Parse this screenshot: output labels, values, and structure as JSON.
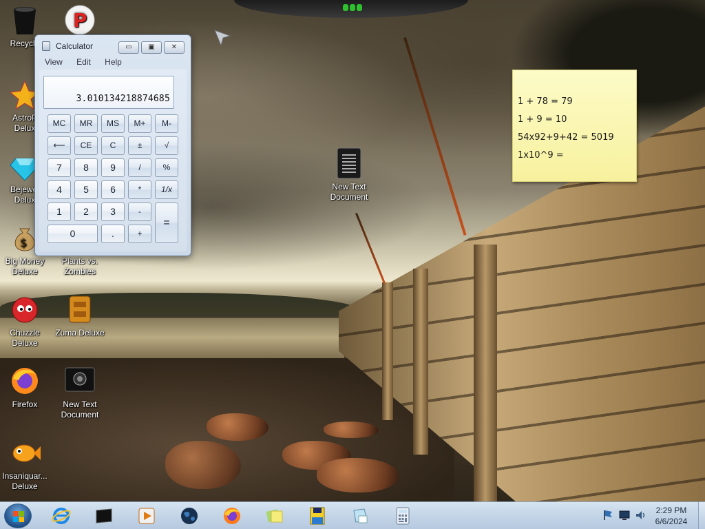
{
  "top_gadget": {},
  "desktop_icons": [
    {
      "id": "recycle-bin",
      "label": "Recycle"
    },
    {
      "id": "p-game",
      "label": ""
    },
    {
      "id": "astropop",
      "label_line1": "AstroP",
      "label_line2": "Delux"
    },
    {
      "id": "bejeweled",
      "label_line1": "Bejewel",
      "label_line2": "Delux"
    },
    {
      "id": "big-money",
      "label_line1": "Big Money",
      "label_line2": "Deluxe"
    },
    {
      "id": "plants-vs-zombies",
      "label_line1": "Plants vs.",
      "label_line2": "Zombies"
    },
    {
      "id": "chuzzle",
      "label_line1": "Chuzzle",
      "label_line2": "Deluxe"
    },
    {
      "id": "zuma",
      "label_line1": "Zuma Deluxe",
      "label_line2": ""
    },
    {
      "id": "firefox",
      "label_line1": "Firefox",
      "label_line2": ""
    },
    {
      "id": "new-text-document-1",
      "label_line1": "New Text",
      "label_line2": "Document"
    },
    {
      "id": "insaniquarium",
      "label_line1": "Insaniquar...",
      "label_line2": "Deluxe"
    },
    {
      "id": "new-text-document-2",
      "label_line1": "New Text",
      "label_line2": "Document"
    }
  ],
  "calculator": {
    "title": "Calculator",
    "window_buttons": {
      "minimize": "▭",
      "maximize": "▣",
      "close": "✕"
    },
    "menu": [
      "View",
      "Edit",
      "Help"
    ],
    "display_value": "3.010134218874685",
    "keys": {
      "mc": "MC",
      "mr": "MR",
      "ms": "MS",
      "mplus": "M+",
      "mminus": "M-",
      "backspace": "⟵",
      "ce": "CE",
      "c": "C",
      "plusminus": "±",
      "sqrt": "√",
      "n7": "7",
      "n8": "8",
      "n9": "9",
      "divide": "/",
      "percent": "%",
      "n4": "4",
      "n5": "5",
      "n6": "6",
      "multiply": "*",
      "reciprocal": "1/x",
      "n1": "1",
      "n2": "2",
      "n3": "3",
      "minus": "-",
      "equals": "=",
      "n0": "0",
      "decimal": ".",
      "plus": "+"
    }
  },
  "sticky_note": {
    "lines": [
      "1 + 78 = 79",
      "1 + 9 = 10",
      "54x92+9+42 = 5019",
      "1x10^9 ="
    ]
  },
  "taskbar": {
    "apps": [
      "Internet Explorer",
      "Media Center",
      "Windows Media Player",
      "Earth",
      "Firefox",
      "Sticky Notes",
      "Games",
      "Snipping Tool",
      "Calculator"
    ],
    "clock_time": "2:29 PM",
    "clock_date": "6/6/2024"
  },
  "colors": {
    "taskbar": "#c5d6e8",
    "sticky_note": "#f7f19e",
    "calculator_frame": "#cdd9e8"
  }
}
